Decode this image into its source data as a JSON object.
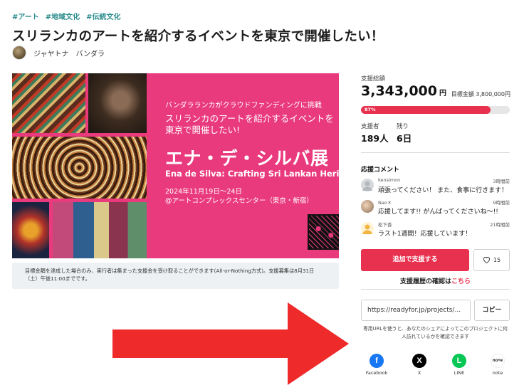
{
  "tags": [
    "#アート",
    "#地域文化",
    "#伝統文化"
  ],
  "title": "スリランカのアートを紹介するイベントを東京で開催したい！",
  "owner": {
    "name": "ジャヤトナ　バンダラ"
  },
  "hero": {
    "sub": "バンダラランカがクラウドファンディングに挑戦",
    "lead": "スリランカのアートを紹介するイベントを東京で開催したい!",
    "big": "エナ・デ・シルバ展",
    "en": "Ena de Silva: Crafting Sri Lankan Heritage",
    "date_line1": "2024年11月19日〜24日",
    "date_line2": "@アートコンプレックスセンター（東京・新宿）"
  },
  "notice": "目標金額を達成した場合のみ、実行者は集まった支援金を受け取ることができます(All-or-Nothing方式)。支援募集は8月31日（土）午後11:00までです。",
  "funding": {
    "total_label": "支援総額",
    "total": "3,343,000",
    "currency": "円",
    "goal": "目標金額 3,800,000円",
    "percent_label": "87%",
    "percent": 0.87,
    "supporters_label": "支援者",
    "supporters": "189人",
    "remaining_label": "残り",
    "remaining": "6日"
  },
  "comments": {
    "title": "応援コメント",
    "items": [
      {
        "name": "kensimon",
        "time": "3時間前",
        "text": "頑張ってください！ また、食事に行きます！"
      },
      {
        "name": "Nao＊",
        "time": "9時間前",
        "text": "応援してます!! がんばってくださいね〜!!"
      },
      {
        "name": "松下香",
        "time": "21時間前",
        "text": "ラスト1週間！応援しています！"
      }
    ]
  },
  "actions": {
    "support": "追加で支援する",
    "fav_count": "15",
    "history_prefix": "支援履歴の確認は",
    "history_link": "こちら"
  },
  "share": {
    "url": "https://readyfor.jp/projects/...",
    "copy": "コピー",
    "note": "専用URLを使うと、あなたのシェアによってこのプロジェクトに何人訪れているかを確認できます",
    "items": [
      {
        "label": "Facebook",
        "glyph": "f",
        "color": "#1877f2"
      },
      {
        "label": "X",
        "glyph": "X",
        "color": "#000000"
      },
      {
        "label": "LINE",
        "glyph": "L",
        "color": "#06c755"
      },
      {
        "label": "note",
        "glyph": "no+e",
        "color": "#ffffff"
      }
    ]
  },
  "colors": {
    "accent": "#e8304f",
    "hero": "#e93a7d",
    "tag": "#2a8c8c",
    "arrow": "#ee2a2a"
  }
}
